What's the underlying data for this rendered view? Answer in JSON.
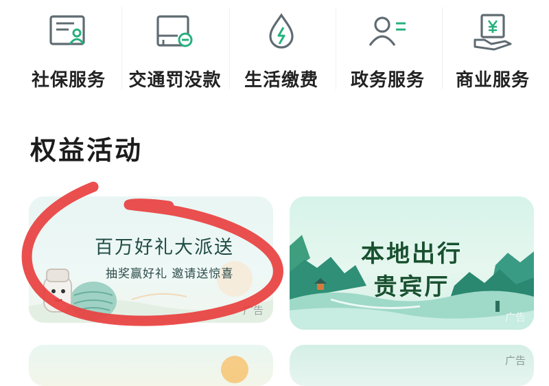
{
  "services": [
    {
      "label": "社保服务",
      "icon": "social-security-card-icon"
    },
    {
      "label": "交通罚没款",
      "icon": "traffic-fine-icon"
    },
    {
      "label": "生活缴费",
      "icon": "utility-payment-icon"
    },
    {
      "label": "政务服务",
      "icon": "government-service-icon"
    },
    {
      "label": "商业服务",
      "icon": "commercial-service-icon"
    }
  ],
  "section": {
    "title": "权益活动"
  },
  "cards": [
    {
      "title": "百万好礼大派送",
      "subtitle": "抽奖赢好礼 邀请送惊喜",
      "ad_label": "广告"
    },
    {
      "title": "本地出行",
      "subtitle": "贵宾厅",
      "ad_label": "广告"
    },
    {
      "ad_label": "广告"
    }
  ],
  "colors": {
    "icon_gray": "#5f6b72",
    "icon_accent": "#25b07d",
    "annotation_red": "#e8403f"
  }
}
